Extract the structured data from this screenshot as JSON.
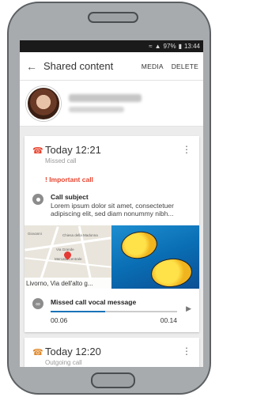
{
  "status": {
    "signal": "▲",
    "battery_percent": "97%",
    "battery_icon": "battery-icon",
    "time": "13:44"
  },
  "appbar": {
    "title": "Shared content",
    "media_label": "MEDIA",
    "delete_label": "DELETE"
  },
  "cards": [
    {
      "time": "Today 12:21",
      "subtitle": "Missed call",
      "important": "! Important call",
      "subject_title": "Call subject",
      "subject_text": "Lorem ipsum dolor sit amet, consectetuer adipiscing elit, sed diam nonummy nibh...",
      "map_address": "Livorno, Via dell'alto g...",
      "map_labels": [
        "Giovanni",
        "Chiesa della Madonna",
        "Via Grande",
        "Mercato Centrale"
      ],
      "vocal_title": "Missed call vocal message",
      "time_elapsed": "00.06",
      "time_total": "00.14",
      "progress": 0.43
    },
    {
      "time": "Today 12:20",
      "subtitle": "Outgoing call"
    }
  ]
}
